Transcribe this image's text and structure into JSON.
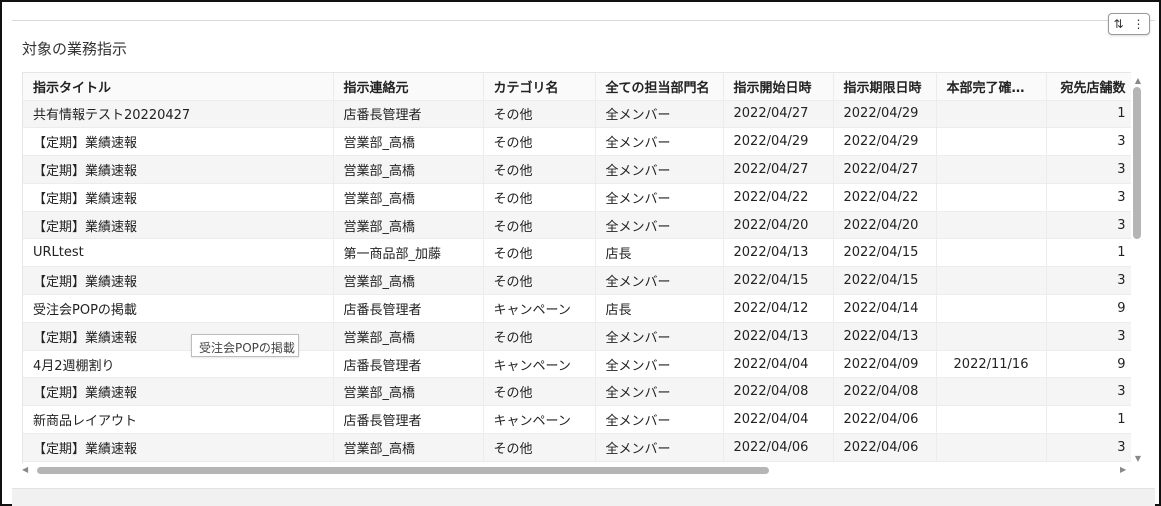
{
  "panel": {
    "title": "対象の業務指示"
  },
  "toolbar": {
    "sort_icon": "⇅",
    "more_icon": "⋮"
  },
  "table": {
    "columns": [
      "指示タイトル",
      "指示連絡元",
      "カテゴリ名",
      "全ての担当部門名",
      "指示開始日時",
      "指示期限日時",
      "本部完了確…",
      "宛先店舗数"
    ],
    "rows": [
      [
        "共有情報テスト20220427",
        "店番長管理者",
        "その他",
        "全メンバー",
        "2022/04/27",
        "2022/04/29",
        "",
        "1"
      ],
      [
        "【定期】業績速報",
        "営業部_高橋",
        "その他",
        "全メンバー",
        "2022/04/29",
        "2022/04/29",
        "",
        "3"
      ],
      [
        "【定期】業績速報",
        "営業部_高橋",
        "その他",
        "全メンバー",
        "2022/04/27",
        "2022/04/27",
        "",
        "3"
      ],
      [
        "【定期】業績速報",
        "営業部_高橋",
        "その他",
        "全メンバー",
        "2022/04/22",
        "2022/04/22",
        "",
        "3"
      ],
      [
        "【定期】業績速報",
        "営業部_高橋",
        "その他",
        "全メンバー",
        "2022/04/20",
        "2022/04/20",
        "",
        "3"
      ],
      [
        "URLtest",
        "第一商品部_加藤",
        "その他",
        "店長",
        "2022/04/13",
        "2022/04/15",
        "",
        "1"
      ],
      [
        "【定期】業績速報",
        "営業部_高橋",
        "その他",
        "全メンバー",
        "2022/04/15",
        "2022/04/15",
        "",
        "3"
      ],
      [
        "受注会POPの掲載",
        "店番長管理者",
        "キャンペーン",
        "店長",
        "2022/04/12",
        "2022/04/14",
        "",
        "9"
      ],
      [
        "【定期】業績速報",
        "営業部_高橋",
        "その他",
        "全メンバー",
        "2022/04/13",
        "2022/04/13",
        "",
        "3"
      ],
      [
        "4月2週棚割り",
        "店番長管理者",
        "キャンペーン",
        "全メンバー",
        "2022/04/04",
        "2022/04/09",
        "2022/11/16",
        "9"
      ],
      [
        "【定期】業績速報",
        "営業部_高橋",
        "その他",
        "全メンバー",
        "2022/04/08",
        "2022/04/08",
        "",
        "3"
      ],
      [
        "新商品レイアウト",
        "店番長管理者",
        "キャンペーン",
        "全メンバー",
        "2022/04/04",
        "2022/04/06",
        "",
        "1"
      ],
      [
        "【定期】業績速報",
        "営業部_高橋",
        "その他",
        "全メンバー",
        "2022/04/06",
        "2022/04/06",
        "",
        "3"
      ]
    ]
  },
  "tooltip": {
    "text": "受注会POPの掲載"
  },
  "scrollbars": {
    "up_arrow": "▲",
    "down_arrow": "▼",
    "left_arrow": "◀",
    "right_arrow": "▶"
  }
}
